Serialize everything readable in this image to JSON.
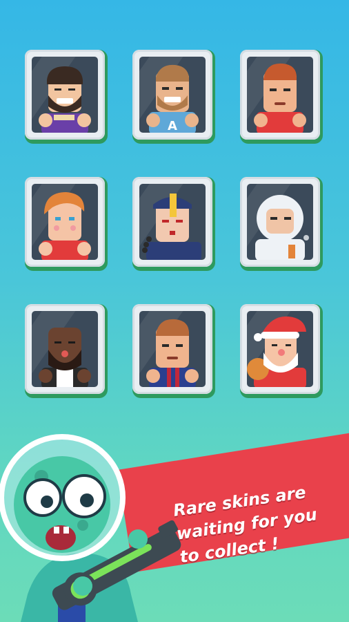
{
  "banner": {
    "line1": "Rare skins are",
    "line2": "waiting for you",
    "line3": "to collect !"
  },
  "colors": {
    "background_top": "#35b7e6",
    "background_bottom": "#6cdcb8",
    "banner": "#e9414b",
    "card_frame": "#e9eef2",
    "card_shadow": "#2e9a5e"
  },
  "skins": [
    {
      "name": "bearded-purple-shirt",
      "jersey_letter": ""
    },
    {
      "name": "blond-captain",
      "jersey_letter": "A"
    },
    {
      "name": "redhead-red-shirt",
      "jersey_letter": ""
    },
    {
      "name": "ginger-girl",
      "jersey_letter": ""
    },
    {
      "name": "jiangshi",
      "jersey_letter": ""
    },
    {
      "name": "astronaut",
      "jersey_letter": ""
    },
    {
      "name": "bald-bearded",
      "jersey_letter": ""
    },
    {
      "name": "striped-jersey",
      "jersey_letter": ""
    },
    {
      "name": "santa",
      "jersey_letter": ""
    }
  ]
}
